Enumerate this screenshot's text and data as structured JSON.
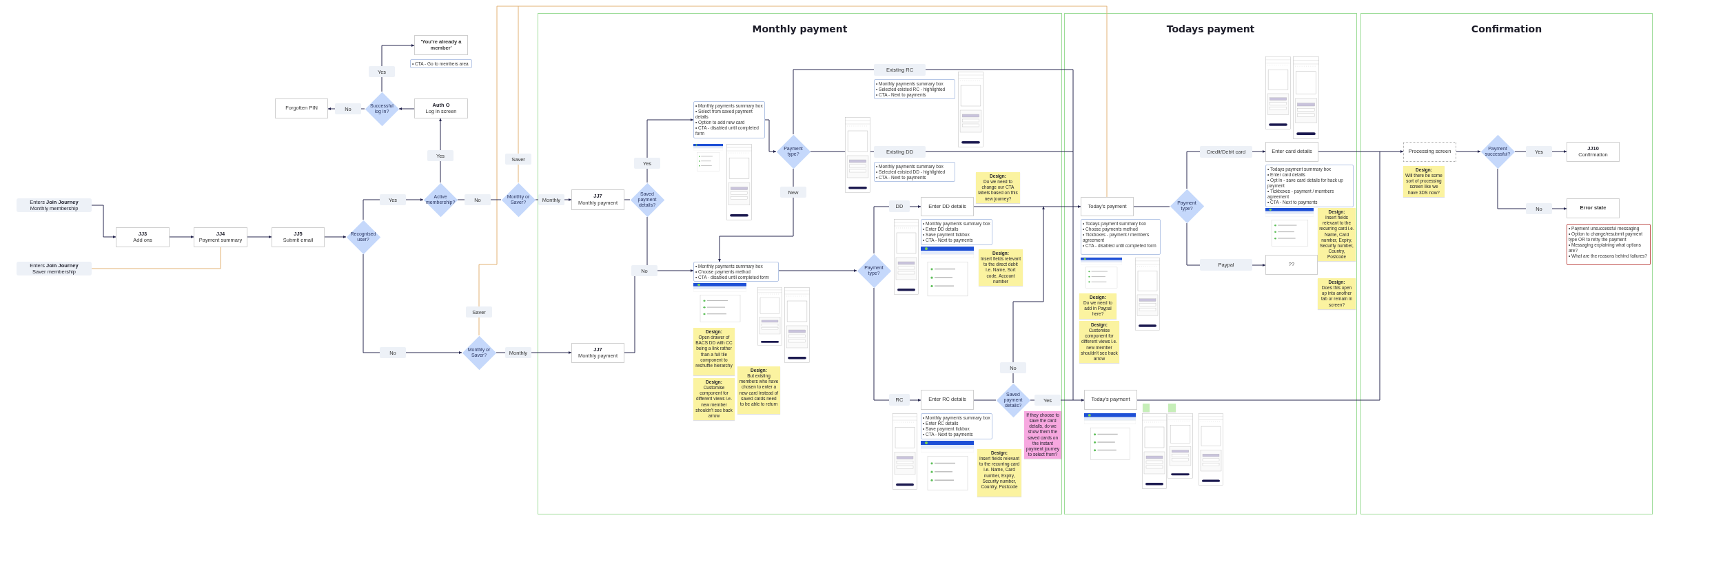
{
  "frames": [
    {
      "title": "Monthly payment"
    },
    {
      "title": "Todays payment"
    },
    {
      "title": "Confirmation"
    }
  ],
  "nodes": [
    {
      "kind": "heading_step",
      "title": "'You're already a member'"
    },
    {
      "kind": "notes",
      "items": [
        "• CTA - Go to members area"
      ]
    },
    {
      "kind": "label",
      "text": "Yes"
    },
    {
      "kind": "label",
      "text": "Existing RC"
    },
    {
      "kind": "notes",
      "items": [
        "• Monthly payments summary box",
        "• Selected existed RC - highlighted",
        "• CTA - Next to payments"
      ]
    },
    {
      "kind": "wireframe"
    },
    {
      "kind": "wireframe"
    },
    {
      "kind": "step",
      "title": "Forgotten PIN"
    },
    {
      "kind": "label",
      "text": "No"
    },
    {
      "kind": "decision",
      "text": "Successful log in?"
    },
    {
      "kind": "step",
      "code": "Auth O",
      "title": "Log in screen"
    },
    {
      "kind": "wireframe"
    },
    {
      "kind": "notes",
      "items": [
        "• Monthly payments summary box",
        "• Select from saved payment details",
        "• Option to add new card",
        "• CTA - disabled until completed form"
      ]
    },
    {
      "kind": "label",
      "text": "Yes"
    },
    {
      "kind": "app_screen"
    },
    {
      "kind": "decision",
      "text": "Payment type?"
    },
    {
      "kind": "wireframe"
    },
    {
      "kind": "label",
      "text": "Existing DD"
    },
    {
      "kind": "label",
      "text": "Credit/Debit card"
    },
    {
      "kind": "step",
      "title": "Enter card details"
    },
    {
      "kind": "pending_step",
      "title": "Processing screen"
    },
    {
      "kind": "decision",
      "text": "Payment successful?"
    },
    {
      "kind": "label",
      "text": "Yes"
    },
    {
      "kind": "step",
      "code": "JJ10",
      "title": "Confirmation"
    },
    {
      "kind": "label",
      "text": "Saver"
    },
    {
      "kind": "label",
      "text": "Yes"
    },
    {
      "kind": "notes",
      "items": [
        "• Monthly payments summary box",
        "• Selected existed DD - highlighted",
        "• CTA - Next to payments"
      ]
    },
    {
      "kind": "wireframe"
    },
    {
      "kind": "label",
      "text": "New"
    },
    {
      "kind": "sticky",
      "color": "#fbf3a0",
      "heading": "Design:",
      "body": "Do we need to change our CTA labels based on this new journey?"
    },
    {
      "kind": "notes",
      "items": [
        "• Todays payment summary box",
        "• Enter card details",
        "• Opt in - save card details for back up payment",
        "• Tickboxes - payment / members agreement",
        "• CTA - Next to payments"
      ]
    },
    {
      "kind": "sticky",
      "color": "#fbf3a0",
      "heading": "Design:",
      "body": "Will there be some sort of processing screen like we have 3DS now?"
    },
    {
      "kind": "entry",
      "text": "Enters **Join Journey**\nMonthly membership"
    },
    {
      "kind": "label",
      "text": "Yes"
    },
    {
      "kind": "decision",
      "text": "Active membership?"
    },
    {
      "kind": "label",
      "text": "No"
    },
    {
      "kind": "decision",
      "text": "Monthly or Saver?"
    },
    {
      "kind": "label",
      "text": "Monthly"
    },
    {
      "kind": "step",
      "code": "JJ7",
      "title": "Monthly payment"
    },
    {
      "kind": "decision",
      "text": "Saved payment details?"
    },
    {
      "kind": "label",
      "text": "DD"
    },
    {
      "kind": "step",
      "title": "Enter DD details"
    },
    {
      "kind": "step",
      "title": "Today's payment"
    },
    {
      "kind": "decision",
      "text": "Payment type?"
    },
    {
      "kind": "label",
      "text": "No"
    },
    {
      "kind": "heading_step",
      "title": "Error state"
    },
    {
      "kind": "step",
      "code": "JJ3",
      "title": "Add ons"
    },
    {
      "kind": "step",
      "code": "JJ4",
      "title": "Payment summary"
    },
    {
      "kind": "step",
      "code": "JJ5",
      "title": "Submit email"
    },
    {
      "kind": "decision",
      "text": "Recognised user?"
    },
    {
      "kind": "notes",
      "items": [
        "• Monthly payments summary box",
        "• Enter DD details",
        "• Save payment tickbox",
        "• CTA - Next to payments"
      ]
    },
    {
      "kind": "notes",
      "items": [
        "• Todays payment summary box",
        "• Choose payments method",
        "• Tickboxes - payment / members agreement",
        "• CTA - disabled until completed form"
      ]
    },
    {
      "kind": "app_screen"
    },
    {
      "kind": "sticky",
      "color": "#fbf3a0",
      "heading": "Design:",
      "body": "Insert fields relevant to the recurring card i.e. Name, Card number, Expiry, Security number, Country, Postcode"
    },
    {
      "kind": "error_notes",
      "items": [
        "• Payment unsuccessful messaging",
        "• Option to change/resubmit payment type OR to retry the payment",
        "• Messaging explaining what options are?",
        "• What are the reasons behind failures?"
      ]
    },
    {
      "kind": "wireframe"
    },
    {
      "kind": "entry",
      "text": "Enters **Join Journey**\nSaver membership"
    },
    {
      "kind": "label",
      "text": "No"
    },
    {
      "kind": "notes",
      "items": [
        "• Monthly payments summary box",
        "• Choose payments method",
        "• CTA - disabled until completed form"
      ]
    },
    {
      "kind": "decision",
      "text": "Payment type?"
    },
    {
      "kind": "app_screen"
    },
    {
      "kind": "sticky",
      "color": "#fbf3a0",
      "heading": "Design:",
      "body": "Insert fields relevant to the direct debit i.e. Name, Sort code, Account number"
    },
    {
      "kind": "app_screen"
    },
    {
      "kind": "label",
      "text": "Paypal"
    },
    {
      "kind": "step",
      "title": "??"
    },
    {
      "kind": "wireframe"
    },
    {
      "kind": "sticky",
      "color": "#fbf3a0",
      "heading": "Design:",
      "body": "Does this open up into another tab or remain in screen?"
    },
    {
      "kind": "label",
      "text": "Saver"
    },
    {
      "kind": "app_screen"
    },
    {
      "kind": "sticky",
      "color": "#fbf3a0",
      "heading": "Design:",
      "body": "Do we need to add in Paypal here?"
    },
    {
      "kind": "wireframe"
    },
    {
      "kind": "wireframe"
    },
    {
      "kind": "sticky",
      "color": "#fbf3a0",
      "heading": "Design:",
      "body": "Customise component for different views i.e. new member shouldn't see back arrow"
    },
    {
      "kind": "label",
      "text": "No"
    },
    {
      "kind": "decision",
      "text": "Monthly or Saver?"
    },
    {
      "kind": "label",
      "text": "Monthly"
    },
    {
      "kind": "step",
      "code": "JJ7",
      "title": "Monthly payment"
    },
    {
      "kind": "sticky",
      "color": "#fbf3a0",
      "heading": "Design:",
      "body": "Open drawer of BACS DD with CC being a link rather than a full tile component to reshuffle hierarchy"
    },
    {
      "kind": "label",
      "text": "No"
    },
    {
      "kind": "sticky",
      "color": "#fbf3a0",
      "heading": "Design:",
      "body": "Customise component for different views i.e. new member shouldn't see back arrow"
    },
    {
      "kind": "sticky",
      "color": "#fbf3a0",
      "heading": "Design:",
      "body": "But existing members who have chosen to enter a new card instead of saved cards need to be able to return"
    },
    {
      "kind": "label",
      "text": "RC"
    },
    {
      "kind": "step",
      "title": "Enter RC details"
    },
    {
      "kind": "decision",
      "text": "Saved payment details?"
    },
    {
      "kind": "label",
      "text": "Yes"
    },
    {
      "kind": "step",
      "title": "Today's payment"
    },
    {
      "kind": "sticky",
      "color": "#c6eeb8"
    },
    {
      "kind": "sticky",
      "color": "#c6eeb8"
    },
    {
      "kind": "notes",
      "items": [
        "• Monthly payments summary box",
        "• Enter RC details",
        "• Save payment tickbox",
        "• CTA - Next to payments"
      ]
    },
    {
      "kind": "sticky",
      "color": "#f7a8e0",
      "body": "If they choose to save the card details, do we show them the saved cards on the instant payment journey to select from?"
    },
    {
      "kind": "app_screen"
    },
    {
      "kind": "wireframe"
    },
    {
      "kind": "wireframe"
    },
    {
      "kind": "wireframe"
    },
    {
      "kind": "wireframe"
    },
    {
      "kind": "app_screen"
    },
    {
      "kind": "sticky",
      "color": "#fbf3a0",
      "heading": "Design:",
      "body": "Insert fields relevant to the recurring card i.e. Name, Card number, Expiry, Security number, Country, Postcode"
    }
  ]
}
